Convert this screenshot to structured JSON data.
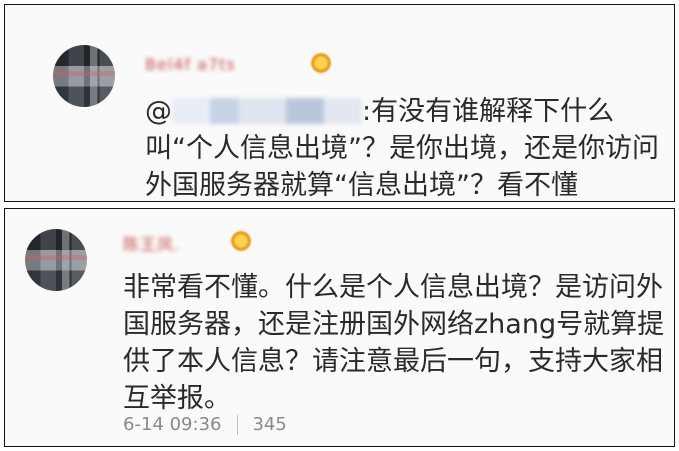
{
  "comments": [
    {
      "username": "Bel4f a7ts",
      "mention": "@",
      "content": ":有没有谁解释下什么叫“个人信息出境”？是你出境，还是你访问外国服务器就算“信息出境”？看不懂"
    },
    {
      "username": "陈王凤.",
      "content": "非常看不懂。什么是个人信息出境？是访问外国服务器，还是注册国外网络zhang号就算提供了本人信息？请注意最后一句，支持大家相互举报。",
      "timestamp": "6-14 09:36",
      "like_count": "345"
    }
  ],
  "colors": {
    "username": "#d9534f",
    "text": "#2a2a2a",
    "meta": "#8a8a8a"
  }
}
